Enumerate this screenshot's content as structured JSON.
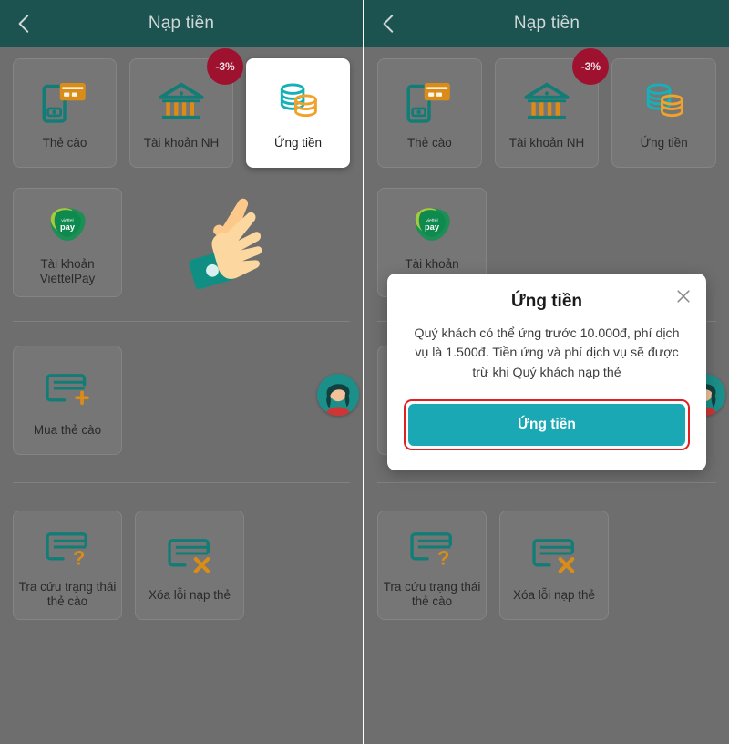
{
  "header": {
    "title": "Nạp tiền",
    "back_icon": "chevron-left-icon",
    "bg": "#1c5250"
  },
  "colors": {
    "teal": "#127d77",
    "orange": "#d98c18",
    "badge_red": "#9e1230",
    "cta_teal": "#19a8b4",
    "annotation_red": "#e02020"
  },
  "left_screen": {
    "row1": [
      {
        "label": "Thẻ cào",
        "icon": "phone-card-icon",
        "highlight": false,
        "badge": null
      },
      {
        "label": "Tài khoản NH",
        "icon": "bank-icon",
        "highlight": false,
        "badge": "-3%"
      },
      {
        "label": "Ứng tiền",
        "icon": "coins-icon",
        "highlight": true,
        "badge": null
      }
    ],
    "row2": [
      {
        "label": "Tài khoản\nViettelPay",
        "label_line1": "Tài khoản",
        "label_line2": "ViettelPay",
        "icon": "viettelpay-logo-icon"
      }
    ],
    "row3": [
      {
        "label": "Mua thẻ cào",
        "icon": "card-plus-icon"
      }
    ],
    "row4": [
      {
        "label_line1": "Tra cứu trạng thái",
        "label_line2": "thẻ cào",
        "icon": "card-question-icon"
      },
      {
        "label_line1": "Xóa lỗi nạp thẻ",
        "label_line2": "",
        "icon": "card-error-icon"
      }
    ],
    "pointer_icon": "pointing-hand-cursor",
    "avatar_icon": "user-avatar"
  },
  "right_screen": {
    "row1": [
      {
        "label": "Thẻ cào",
        "icon": "phone-card-icon",
        "badge": null
      },
      {
        "label": "Tài khoản NH",
        "icon": "bank-icon",
        "badge": "-3%"
      },
      {
        "label": "Ứng tiền",
        "icon": "coins-icon",
        "badge": null
      }
    ],
    "row2": [
      {
        "label_line1": "Tài khoản",
        "label_line2": "ViettelPay",
        "icon": "viettelpay-logo-icon"
      }
    ],
    "row4": [
      {
        "label_line1": "Tra cứu trạng thái",
        "label_line2": "thẻ cào",
        "icon": "card-question-icon"
      },
      {
        "label_line1": "Xóa lỗi nạp thẻ",
        "label_line2": "",
        "icon": "card-error-icon"
      }
    ],
    "avatar_icon": "user-avatar"
  },
  "dialog": {
    "title": "Ứng tiền",
    "close_icon": "close-icon",
    "body": "Quý khách có thể ứng trước 10.000đ, phí dịch vụ là 1.500đ. Tiền ứng và phí dịch vụ sẽ được trừ khi Quý khách nạp thẻ",
    "cta_label": "Ứng tiền",
    "advance_amount": "10.000đ",
    "service_fee": "1.500đ"
  }
}
